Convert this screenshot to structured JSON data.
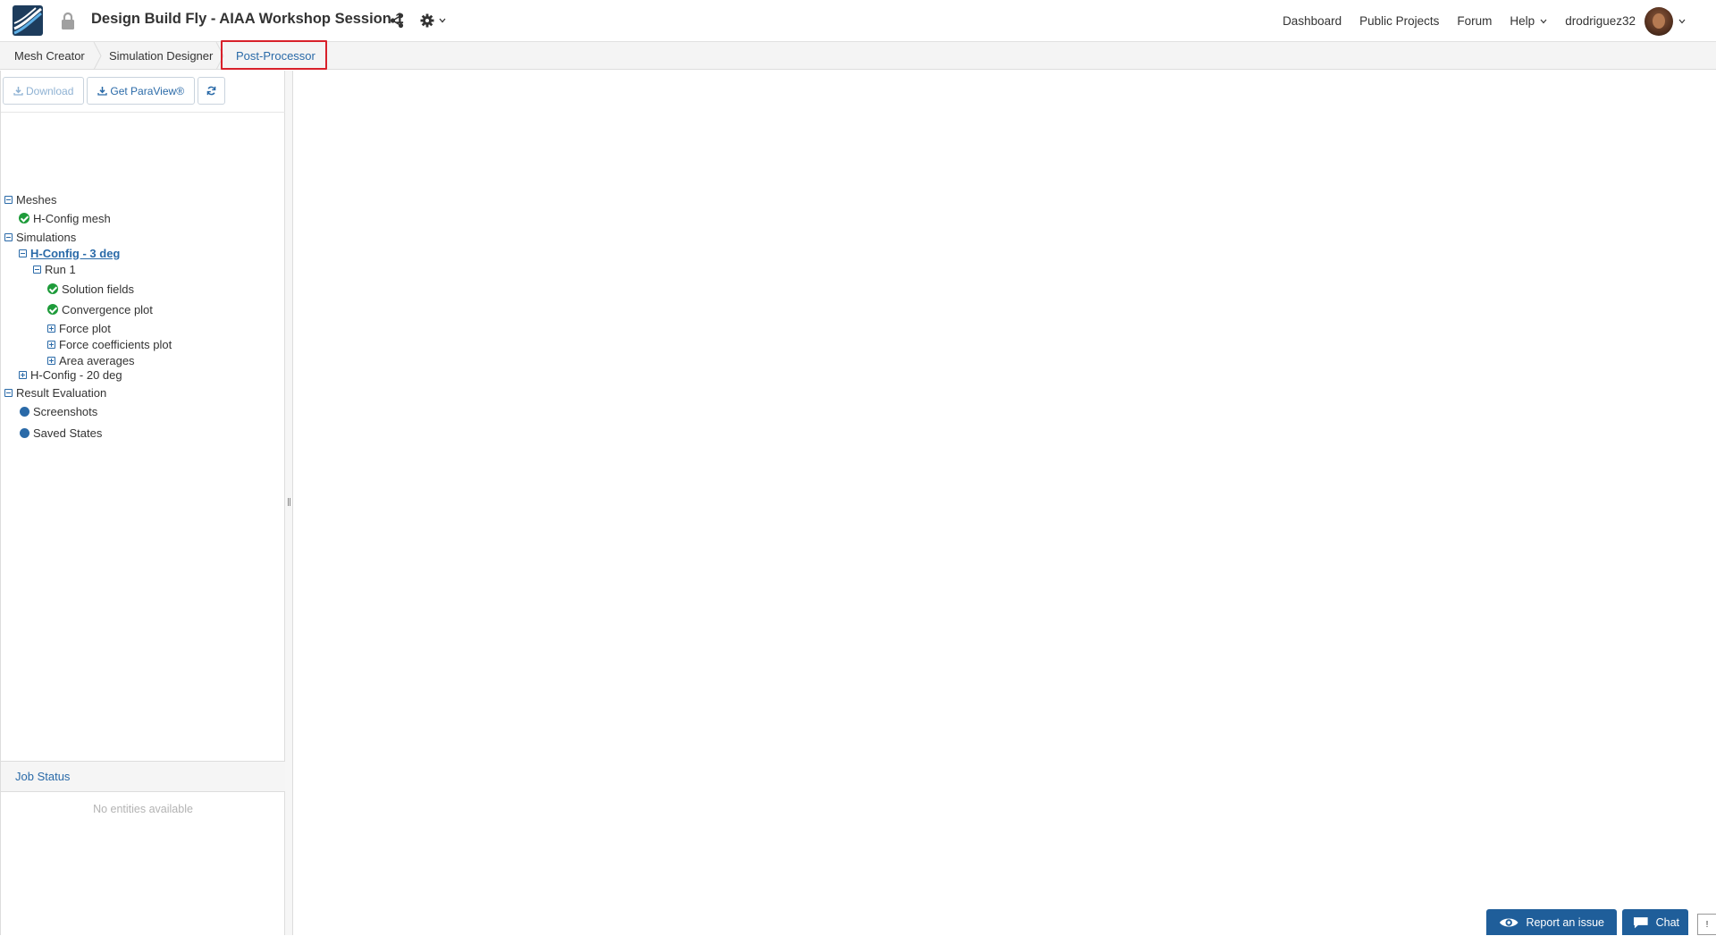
{
  "header": {
    "project_title": "Design Build Fly - AIAA Workshop Session 1",
    "nav": {
      "dashboard": "Dashboard",
      "public_projects": "Public Projects",
      "forum": "Forum",
      "help": "Help",
      "username": "drodriguez32"
    }
  },
  "tabs": {
    "mesh_creator": "Mesh Creator",
    "simulation_designer": "Simulation Designer",
    "post_processor": "Post-Processor",
    "active": "Post-Processor"
  },
  "toolbar": {
    "download": "Download",
    "get_paraview": "Get ParaView®"
  },
  "tree": {
    "meshes": "Meshes",
    "h_config_mesh": "H-Config mesh",
    "simulations": "Simulations",
    "sim_3deg": "H-Config - 3 deg",
    "run1": "Run 1",
    "solution_fields": "Solution fields",
    "convergence_plot": "Convergence plot",
    "force_plot": "Force plot",
    "force_coefficients_plot": "Force coefficients plot",
    "area_averages": "Area averages",
    "sim_20deg": "H-Config - 20 deg",
    "result_evaluation": "Result Evaluation",
    "screenshots": "Screenshots",
    "saved_states": "Saved States"
  },
  "job_status": {
    "title": "Job Status",
    "empty": "No entities available"
  },
  "floating": {
    "report_issue": "Report an issue",
    "chat": "Chat",
    "edge": "!"
  },
  "colors": {
    "accent": "#2a6aa8",
    "success": "#1e9b3a",
    "highlight_border": "#d8202a",
    "floating_button": "#1f5e9a"
  }
}
